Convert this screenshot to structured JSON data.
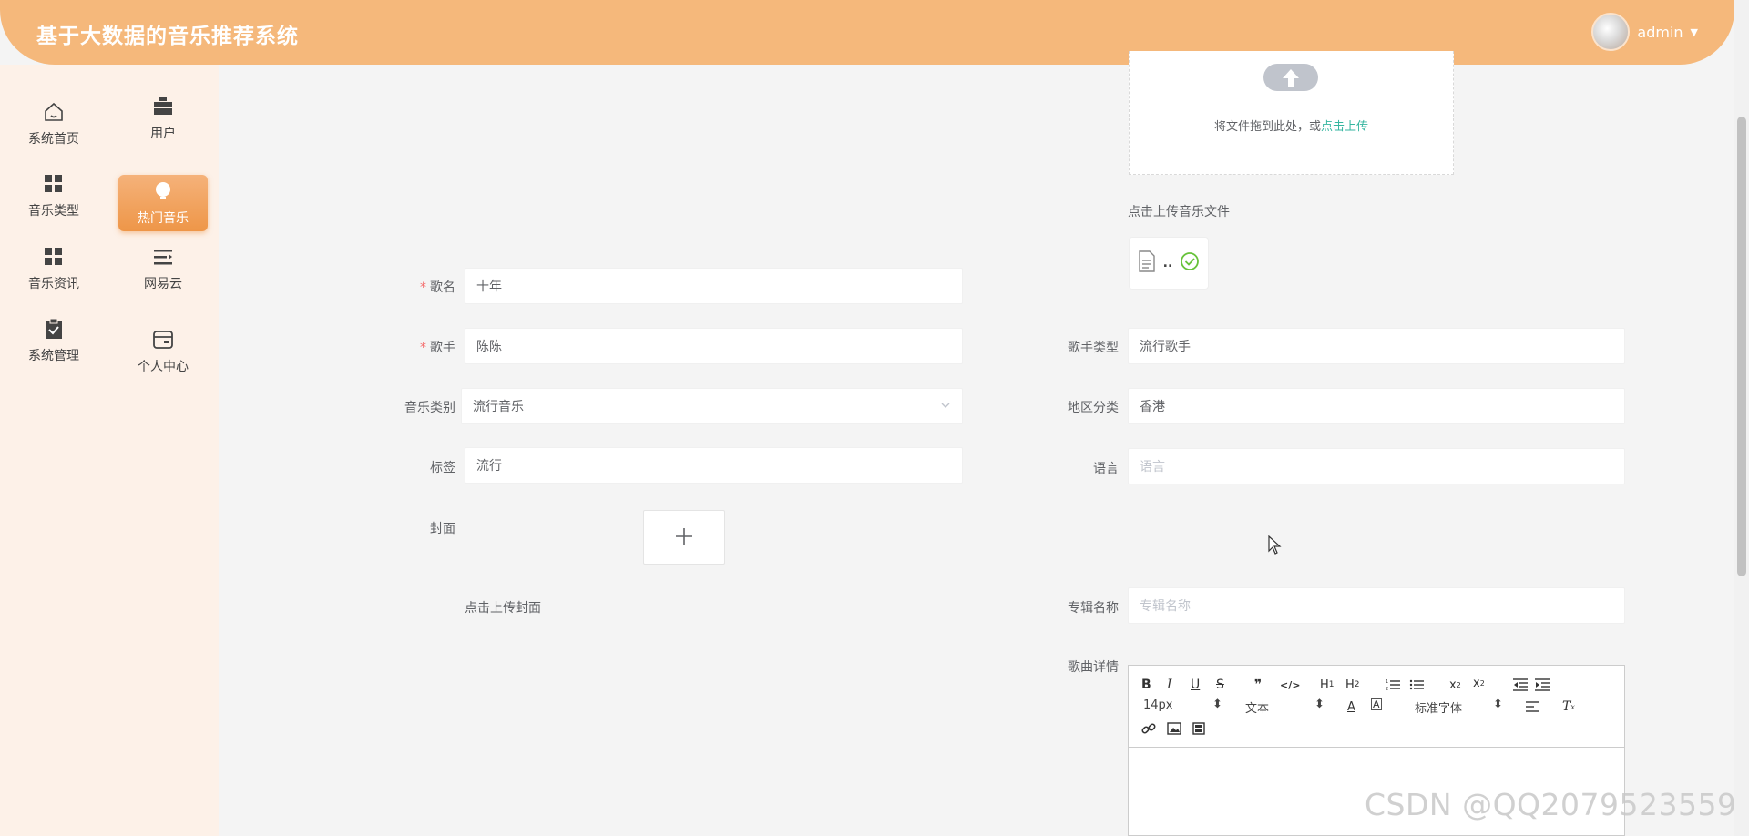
{
  "header": {
    "title": "基于大数据的音乐推荐系统",
    "username": "admin"
  },
  "sidebar": {
    "items": [
      {
        "label": "系统首页",
        "icon": "home-icon"
      },
      {
        "label": "用户",
        "icon": "briefcase-icon"
      },
      {
        "label": "音乐类型",
        "icon": "grid-icon"
      },
      {
        "label": "热门音乐",
        "icon": "bulb-icon",
        "active": true
      },
      {
        "label": "音乐资讯",
        "icon": "grid-icon"
      },
      {
        "label": "网易云",
        "icon": "list-icon"
      },
      {
        "label": "系统管理",
        "icon": "clipboard-check-icon"
      },
      {
        "label": "个人中心",
        "icon": "card-icon"
      }
    ]
  },
  "upload_music": {
    "drag_text": "将文件拖到此处，或",
    "drag_link": "点击上传",
    "hint": "点击上传音乐文件",
    "file_name": ".."
  },
  "form": {
    "song_name": {
      "label": "歌名",
      "value": "十年"
    },
    "singer": {
      "label": "歌手",
      "value": "陈陈"
    },
    "singer_type": {
      "label": "歌手类型",
      "value": "流行歌手"
    },
    "music_category": {
      "label": "音乐类别",
      "value": "流行音乐"
    },
    "region": {
      "label": "地区分类",
      "value": "香港"
    },
    "tags": {
      "label": "标签",
      "value": "流行"
    },
    "language": {
      "label": "语言",
      "placeholder": "语言"
    },
    "cover": {
      "label": "封面",
      "hint": "点击上传封面"
    },
    "album": {
      "label": "专辑名称",
      "placeholder": "专辑名称"
    },
    "details": {
      "label": "歌曲详情"
    }
  },
  "editor": {
    "font_size": "14px",
    "header_type": "文本",
    "font_family": "标准字体"
  },
  "watermark": "CSDN @QQ2079523559",
  "colors": {
    "header_bg": "#f5b87b",
    "active_nav": "#ee9648",
    "link": "#36b6a0",
    "required": "#f56c6c"
  }
}
